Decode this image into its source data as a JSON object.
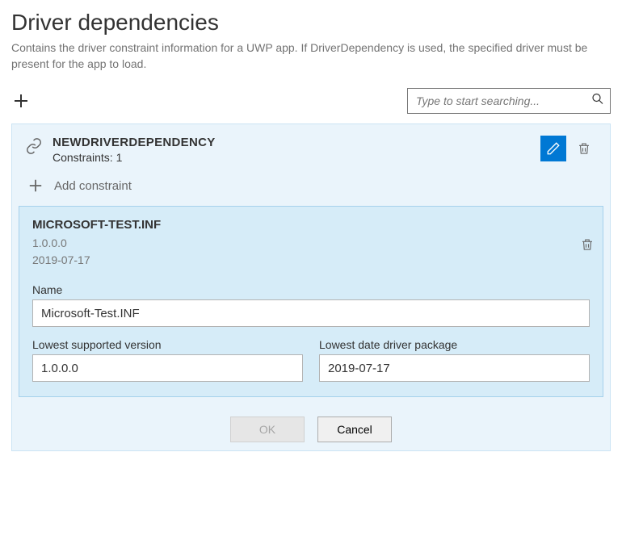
{
  "header": {
    "title": "Driver dependencies",
    "description": "Contains the driver constraint information for a UWP app. If DriverDependency is used, the specified driver must be present for the app to load."
  },
  "search": {
    "placeholder": "Type to start searching..."
  },
  "dependency": {
    "title": "NEWDRIVERDEPENDENCY",
    "constraints_label": "Constraints: 1",
    "add_constraint_label": "Add constraint"
  },
  "constraint": {
    "title": "MICROSOFT-TEST.INF",
    "version_meta": "1.0.0.0",
    "date_meta": "2019-07-17",
    "fields": {
      "name_label": "Name",
      "name_value": "Microsoft-Test.INF",
      "version_label": "Lowest supported version",
      "version_value": "1.0.0.0",
      "date_label": "Lowest date driver package",
      "date_value": "2019-07-17"
    }
  },
  "buttons": {
    "ok": "OK",
    "cancel": "Cancel"
  }
}
